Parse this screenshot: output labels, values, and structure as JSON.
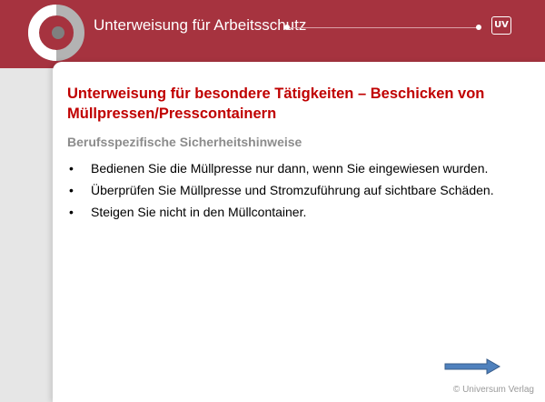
{
  "header": {
    "title": "Unterweisung für Arbeitsschutz",
    "logo_icon": "circle-logo-icon",
    "badge_text": "UV",
    "colors": {
      "bar": "#a6333f",
      "logo_gray": "#b3b3b3",
      "logo_red": "#a6333f"
    }
  },
  "slide": {
    "title": "Unterweisung für besondere Tätigkeiten – Beschicken von Müllpressen/Presscontainern",
    "subtitle": "Berufsspezifische Sicherheitshinweise",
    "bullets": [
      "Bedienen Sie die Müllpresse nur dann, wenn Sie eingewiesen wurden.",
      "Überprüfen Sie Müllpresse und Stromzuführung auf sichtbare Schäden.",
      "Steigen Sie nicht in den Müllcontainer."
    ],
    "bullet_symbol": "•",
    "title_color": "#c00000"
  },
  "navigation": {
    "next_icon": "arrow-right-icon",
    "arrow_color": "#4f81bd"
  },
  "footer": {
    "copyright": "© Universum Verlag"
  }
}
